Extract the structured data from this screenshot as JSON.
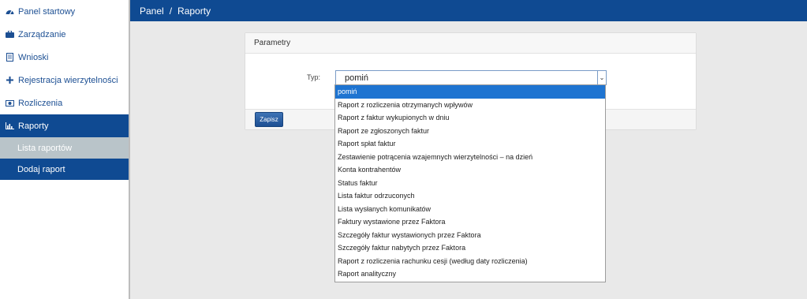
{
  "sidebar": {
    "items": [
      {
        "label": "Panel startowy",
        "icon": "dashboard-icon"
      },
      {
        "label": "Zarządzanie",
        "icon": "briefcase-icon"
      },
      {
        "label": "Wnioski",
        "icon": "document-icon"
      },
      {
        "label": "Rejestracja wierzytelności",
        "icon": "plus-icon"
      },
      {
        "label": "Rozliczenia",
        "icon": "money-icon"
      },
      {
        "label": "Raporty",
        "icon": "bar-chart-icon"
      }
    ],
    "sub_items": [
      {
        "label": "Lista raportów"
      },
      {
        "label": "Dodaj raport"
      }
    ]
  },
  "breadcrumb": {
    "root": "Panel",
    "sep": "/",
    "current": "Raporty"
  },
  "panel": {
    "title": "Parametry",
    "typ_label": "Typ:",
    "select_value": "pomiń",
    "save_label": "Zapisz"
  },
  "dropdown": {
    "options": [
      "pomiń",
      "Raport z rozliczenia otrzymanych wpływów",
      "Raport z faktur wykupionych w dniu",
      "Raport ze zgłoszonych faktur",
      "Raport spłat faktur",
      "Zestawienie potrącenia wzajemnych wierzytelności – na dzień",
      "Konta kontrahentów",
      "Status faktur",
      "Lista faktur odrzuconych",
      "Lista wysłanych komunikatów",
      "Faktury wystawione przez Faktora",
      "Szczegóły faktur wystawionych przez Faktora",
      "Szczegóły faktur nabytych przez Faktora",
      "Raport z rozliczenia rachunku cesji (według daty rozliczenia)",
      "Raport analityczny"
    ]
  },
  "colors": {
    "brand": "#0f4a92",
    "selected": "#1e74d1",
    "submenu_current": "#b9c4c9"
  }
}
